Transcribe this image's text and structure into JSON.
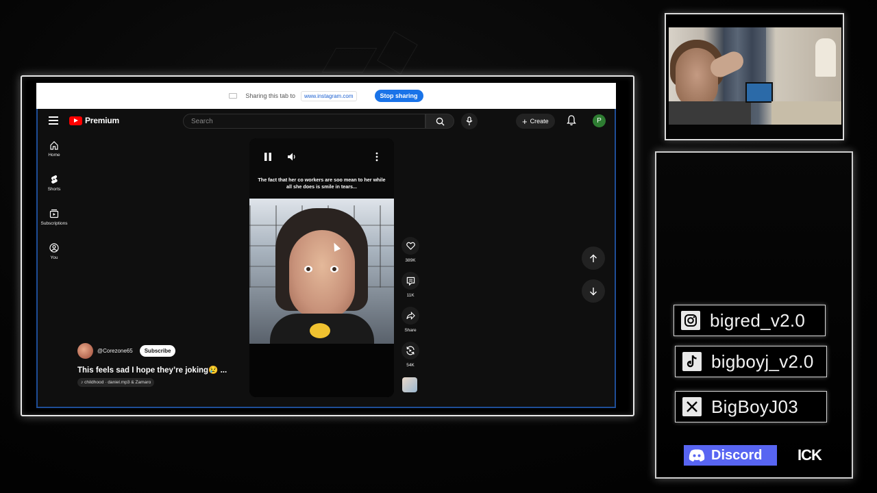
{
  "share_bar": {
    "text": "Sharing this tab to",
    "site": "www.instagram.com",
    "stop_label": "Stop sharing"
  },
  "youtube": {
    "brand": "Premium",
    "search_placeholder": "Search",
    "create_label": "Create",
    "avatar_letter": "P",
    "nav": [
      {
        "label": "Home",
        "icon": "home-icon"
      },
      {
        "label": "Shorts",
        "icon": "shorts-icon"
      },
      {
        "label": "Subscriptions",
        "icon": "subscriptions-icon"
      },
      {
        "label": "You",
        "icon": "you-icon"
      }
    ],
    "short": {
      "caption": "The fact that her co workers are soo mean to her while all she does is smile in tears...",
      "likes": "389K",
      "comments": "11K",
      "share_label": "Share",
      "remix": "54K",
      "channel": "@Corezone65",
      "subscribe_label": "Subscribe",
      "title": "This feels sad I hope they’re joking😢  ...",
      "music": "♪ childhood · daniel.mp3 & Zamaro"
    }
  },
  "socials": [
    {
      "platform": "instagram",
      "handle": "bigred_v2.0"
    },
    {
      "platform": "tiktok",
      "handle": "bigboyj_v2.0"
    },
    {
      "platform": "x",
      "handle": "BigBoyJ03"
    }
  ],
  "discord_label": "Discord",
  "extra_label": "ICK",
  "colors": {
    "youtube_red": "#ff0000",
    "share_blue": "#1a73e8",
    "discord": "#5865f2",
    "avatar_green": "#2e7d32"
  }
}
